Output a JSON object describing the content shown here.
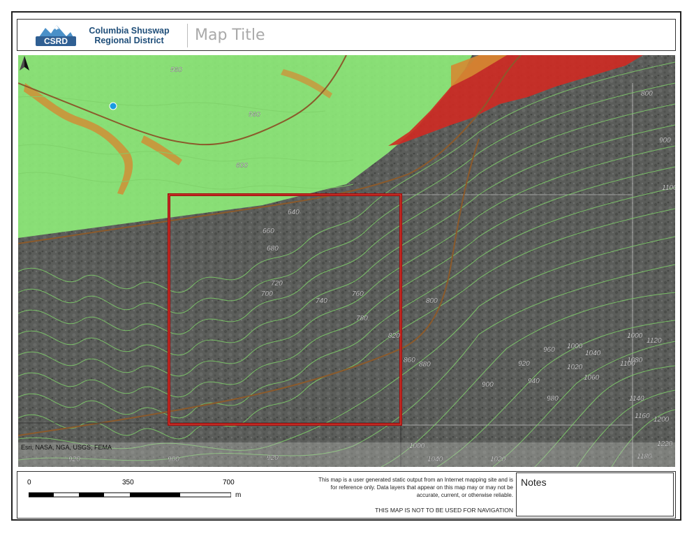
{
  "header": {
    "logo_text": "CSRD",
    "org_line1": "Columbia Shuswap",
    "org_line2": "Regional District",
    "map_title": "Map Title"
  },
  "map": {
    "attribution": "Esri, NASA, NGA, USGS, FEMA",
    "contour_labels": [
      "560",
      "560",
      "600",
      "640",
      "660",
      "680",
      "700",
      "720",
      "740",
      "760",
      "780",
      "800",
      "800",
      "820",
      "860",
      "880",
      "900",
      "900",
      "920",
      "920",
      "920",
      "940",
      "960",
      "980",
      "1000",
      "1000",
      "1000",
      "1020",
      "1020",
      "1040",
      "1040",
      "1060",
      "1080",
      "1100",
      "1100",
      "1120",
      "1140",
      "1160",
      "1180",
      "1200",
      "1220",
      "900"
    ],
    "colors": {
      "imagery": "#5d5f5c",
      "green_zone": "#8ff07a",
      "red_zone": "#cf2a22",
      "orange_zone": "#d58a32",
      "contour": "#7fd16a",
      "road": "#8b5a2b",
      "selection_box": "#a10d0d",
      "point": "#1a9be0"
    },
    "icons": {
      "north_arrow": "north-arrow-icon",
      "point": "location-point-icon"
    }
  },
  "footer": {
    "scale": {
      "label_0": "0",
      "label_mid": "350",
      "label_max": "700",
      "unit": "m"
    },
    "disclaimer_line1": "This map is a user generated static output from an Internet mapping site and is",
    "disclaimer_line2": "for reference only. Data layers that appear on this map may or may not be",
    "disclaimer_line3": "accurate, current, or otherwise reliable.",
    "nav_warning": "THIS MAP IS NOT TO BE USED FOR NAVIGATION",
    "notes_label": "Notes"
  }
}
